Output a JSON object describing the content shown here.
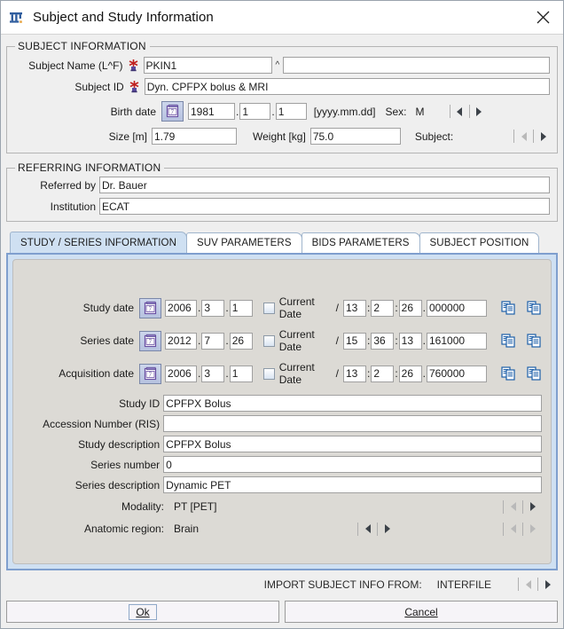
{
  "window": {
    "title": "Subject and Study Information",
    "app_icon": "pmod-logo-icon",
    "close_icon": "close-icon"
  },
  "subject_information": {
    "legend": "SUBJECT INFORMATION",
    "subject_name": {
      "label": "Subject Name (L^F)",
      "required_icon": "required-asterisk-icon",
      "last_name_value": "PKIN1",
      "separator": "^",
      "first_name_value": ""
    },
    "subject_id": {
      "label": "Subject ID",
      "required_icon": "required-asterisk-icon",
      "value": "Dyn. CPFPX bolus & MRI"
    },
    "birth_date": {
      "label": "Birth date",
      "calendar_icon": "calendar-icon",
      "year": "1981",
      "month": "1",
      "day": "1",
      "format_hint": "[yyyy.mm.dd]"
    },
    "sex": {
      "label": "Sex:",
      "value": "M"
    },
    "size": {
      "label": "Size [m]",
      "value": "1.79"
    },
    "weight": {
      "label": "Weight [kg]",
      "value": "75.0"
    },
    "subject_preset": {
      "label": "Subject:",
      "value": ""
    }
  },
  "referring_information": {
    "legend": "REFERRING INFORMATION",
    "referred_by": {
      "label": "Referred by",
      "value": "Dr. Bauer"
    },
    "institution": {
      "label": "Institution",
      "value": "ECAT"
    }
  },
  "tabs": [
    {
      "label": "STUDY / SERIES INFORMATION",
      "active": true
    },
    {
      "label": "SUV PARAMETERS",
      "active": false
    },
    {
      "label": "BIDS PARAMETERS",
      "active": false
    },
    {
      "label": "SUBJECT POSITION",
      "active": false
    }
  ],
  "study_series": {
    "current_date_label": "Current Date",
    "slash": "/",
    "dot": ".",
    "colon": ":",
    "copy_icon": "copy-icon",
    "paste_icon": "paste-icon",
    "calendar_icon": "calendar-icon",
    "dates": [
      {
        "label": "Study date",
        "year": "2006",
        "month": "3",
        "day": "1",
        "current_date_checked": false,
        "hour": "13",
        "minute": "2",
        "second": "26",
        "fraction": "000000"
      },
      {
        "label": "Series date",
        "year": "2012",
        "month": "7",
        "day": "26",
        "current_date_checked": false,
        "hour": "15",
        "minute": "36",
        "second": "13",
        "fraction": "161000"
      },
      {
        "label": "Acquisition date",
        "year": "2006",
        "month": "3",
        "day": "1",
        "current_date_checked": false,
        "hour": "13",
        "minute": "2",
        "second": "26",
        "fraction": "760000"
      }
    ],
    "fields": [
      {
        "label": "Study ID",
        "value": "CPFPX Bolus"
      },
      {
        "label": "Accession Number (RIS)",
        "value": ""
      },
      {
        "label": "Study description",
        "value": "CPFPX Bolus"
      },
      {
        "label": "Series number",
        "value": "0"
      },
      {
        "label": "Series description",
        "value": "Dynamic PET"
      }
    ],
    "modality": {
      "label": "Modality:",
      "value": "PT [PET]"
    },
    "anatomic_region": {
      "label": "Anatomic region:",
      "value": "Brain"
    }
  },
  "footer": {
    "import_label": "IMPORT SUBJECT INFO FROM:",
    "import_value": "INTERFILE",
    "ok_label": "Ok",
    "cancel_label": "Cancel"
  },
  "colors": {
    "accent_blue": "#7f9fce",
    "tab_active": "#cfe0f2",
    "panel_gray": "#dcdad5",
    "window_gray": "#efefef"
  }
}
